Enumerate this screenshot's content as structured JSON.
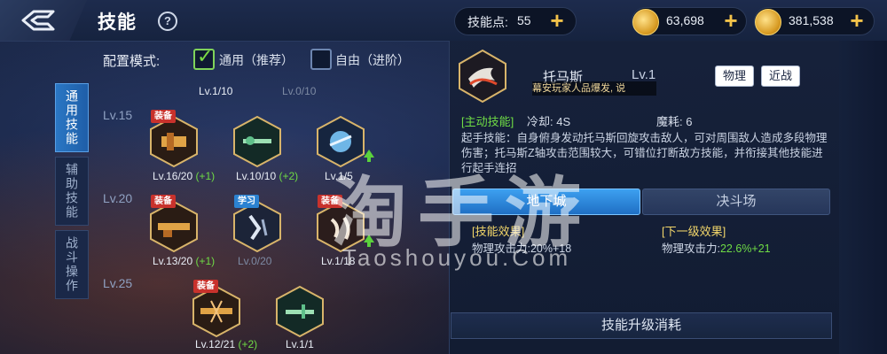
{
  "header": {
    "title": "技能",
    "help_icon": "?",
    "skill_points_label": "技能点:",
    "skill_points_value": "55",
    "gold_value": "63,698",
    "coupon_value": "381,538"
  },
  "tabs": [
    {
      "label": "通用技能",
      "active": true
    },
    {
      "label": "辅助技能",
      "active": false
    },
    {
      "label": "战斗操作",
      "active": false
    }
  ],
  "config": {
    "label": "配置模式:",
    "option_general": "通用（推荐）",
    "option_free": "自由（进阶）",
    "selected": "general"
  },
  "tree": {
    "top_row": [
      {
        "level": "Lv.1/10"
      },
      {
        "level": "Lv.0/10"
      }
    ],
    "tiers": [
      {
        "label": "Lv.15",
        "skills": [
          {
            "badge": "装备",
            "level": "Lv.16/20",
            "bonus": "(+1)"
          },
          {
            "badge": "",
            "level": "Lv.10/10",
            "bonus": "(+2)"
          },
          {
            "badge": "",
            "level": "Lv.1/5",
            "bonus": "",
            "upgradable": true
          }
        ]
      },
      {
        "label": "Lv.20",
        "skills": [
          {
            "badge": "装备",
            "level": "Lv.13/20",
            "bonus": "(+1)"
          },
          {
            "badge": "学习",
            "level": "Lv.0/20",
            "bonus": ""
          },
          {
            "badge": "装备",
            "level": "Lv.1/18",
            "bonus": "",
            "upgradable": true
          }
        ]
      },
      {
        "label": "Lv.25",
        "skills": [
          {
            "badge": "装备",
            "level": "Lv.12/21",
            "bonus": "(+2)"
          },
          {
            "badge": "",
            "level": "Lv.1/1",
            "bonus": ""
          }
        ]
      }
    ]
  },
  "detail": {
    "skill_name": "托马斯",
    "skill_level": "Lv.1",
    "marquee": "幕安玩家人品爆发, 说",
    "tag_physical": "物理",
    "tag_melee": "近战",
    "active_tag": "[主动技能]",
    "cooldown": "冷却: 4S",
    "mana": "魔耗: 6",
    "description": "起手技能：自身俯身发动托马斯回旋攻击敌人，可对周围敌人造成多段物理伤害；托马斯Z轴攻击范围较大，可错位打断敌方技能，并衔接其他技能进行起手连招",
    "mode_dungeon": "地下城",
    "mode_arena": "决斗场",
    "current_effect_title": "[技能效果]",
    "current_effect_label": "物理攻击力:",
    "current_effect_value": "20%+18",
    "next_effect_title": "[下一级效果]",
    "next_effect_label": "物理攻击力:",
    "next_effect_value": "22.6%+21",
    "upgrade_cost_label": "技能升级消耗"
  },
  "watermark": {
    "main": "淘手游",
    "sub": "Taoshouyou.Com"
  }
}
